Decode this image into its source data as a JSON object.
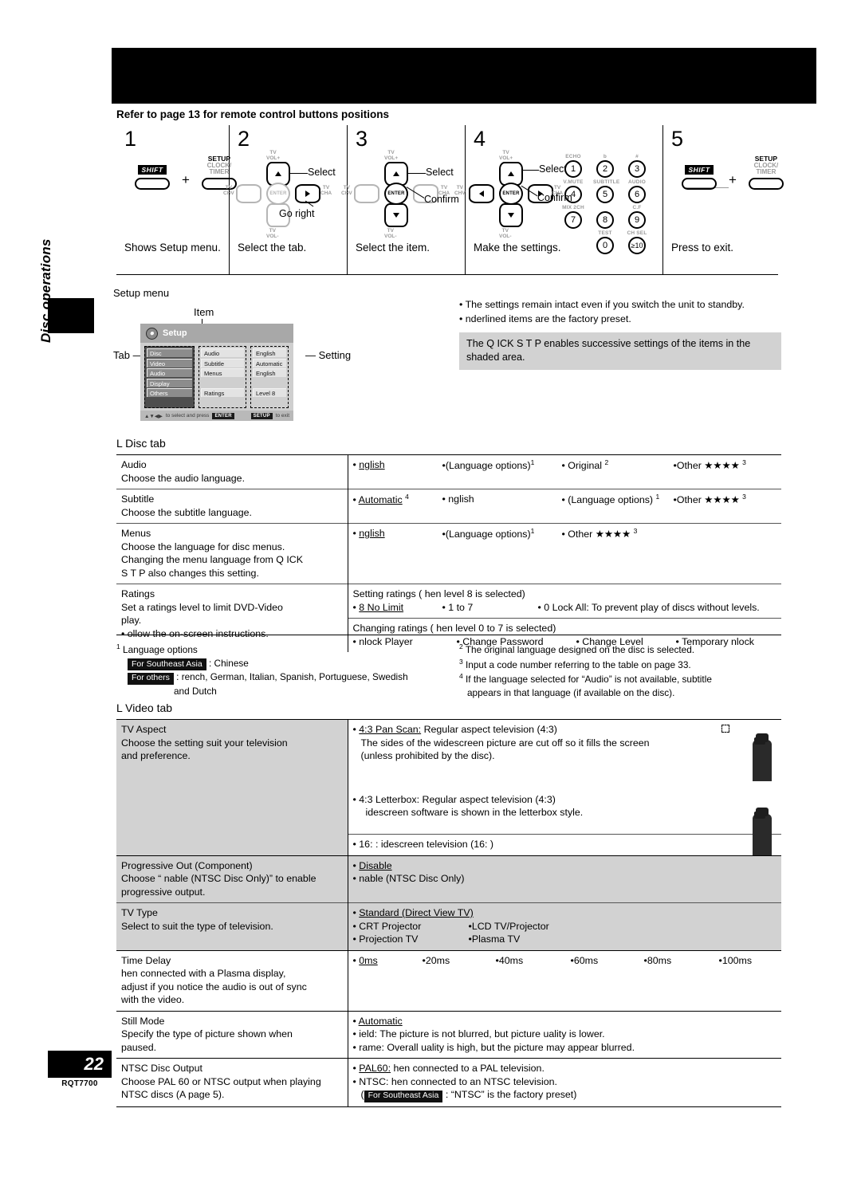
{
  "sidebar": {
    "section_label": "Disc operations",
    "page_number": "22",
    "doc_code": "RQT7700"
  },
  "header": {
    "refer_note": "Refer to page 13 for remote control buttons positions"
  },
  "steps": [
    {
      "number": "1",
      "caption": "Shows Setup menu.",
      "keys": {
        "shift": "SHIFT",
        "plus": "+",
        "setup": "SETUP",
        "setup_sub1": "CLOCK/",
        "setup_sub2": "TIMER"
      }
    },
    {
      "number": "2",
      "caption": "Select the tab.",
      "callouts": [
        "Select",
        "Go right"
      ],
      "pad_tags": {
        "up": "TV\nVOL+",
        "down": "TV\nVOL-",
        "left": "TV\nCHV",
        "right": "TV\nCHA",
        "center": "ENTER"
      }
    },
    {
      "number": "3",
      "caption": "Select the item.",
      "callouts": [
        "Select",
        "Confirm"
      ],
      "pad_tags": {
        "up": "TV\nVOL+",
        "down": "TV\nVOL-",
        "left": "TV\nCHV",
        "right": "TV\nCHA",
        "center": "ENTER"
      }
    },
    {
      "number": "4",
      "caption": "Make the settings.",
      "callouts": [
        "Select",
        "Confirm"
      ],
      "keypad": [
        {
          "top": "ECHO",
          "label": "1"
        },
        {
          "top": "b",
          "label": "2"
        },
        {
          "top": "#",
          "label": "3"
        },
        {
          "top": "V.MUTE",
          "label": "4"
        },
        {
          "top": "SUBTITLE",
          "label": "5"
        },
        {
          "top": "AUDIO",
          "label": "6"
        },
        {
          "top": "MIX 2CH",
          "label": "7"
        },
        {
          "top": "",
          "label": "8"
        },
        {
          "top": "C.F",
          "label": "9"
        },
        {
          "top": "",
          "label": ""
        },
        {
          "top": "TEST",
          "label": "0"
        },
        {
          "top": "CH SEL",
          "label": "≥10"
        }
      ]
    },
    {
      "number": "5",
      "caption": "Press to exit.",
      "keys": {
        "shift": "SHIFT",
        "plus": "+",
        "setup": "SETUP",
        "setup_sub1": "CLOCK/",
        "setup_sub2": "TIMER"
      }
    }
  ],
  "figure": {
    "title": "Setup menu",
    "label_item": "Item",
    "label_tab": "Tab",
    "label_setting": "Setting",
    "screen_title": "Setup",
    "tabs": [
      "Disc",
      "Video",
      "Audio",
      "Display",
      "Others"
    ],
    "items": [
      "Audio",
      "Subtitle",
      "Menus",
      "",
      "Ratings"
    ],
    "settings": [
      "English",
      "Automatic",
      "English",
      "",
      "Level 8"
    ],
    "footer_left": "to select and press",
    "footer_enter": "ENTER",
    "footer_exit_key": "SETUP",
    "footer_exit": "to exit"
  },
  "notes": {
    "bullets": [
      "The settings remain intact even if you switch the unit to standby.",
      " nderlined items are the factory preset."
    ],
    "tip": "The Q ICK S T P enables successive settings of the items in the shaded area."
  },
  "disc_tab": {
    "heading": "L   Disc   tab",
    "rows": [
      {
        "name": "Audio",
        "desc": [
          "Choose the audio language."
        ],
        "options": [
          {
            "text": " nglish",
            "underline": true
          },
          {
            "text": "(Language options)",
            "sup": "1"
          },
          {
            "text": "Original",
            "sup": "2"
          },
          {
            "text": "Other ★★★★",
            "sup": "3"
          }
        ]
      },
      {
        "name": "Subtitle",
        "desc": [
          "Choose the subtitle language."
        ],
        "options": [
          {
            "text": "Automatic",
            "underline": true,
            "sup": "4"
          },
          {
            "text": " nglish"
          },
          {
            "text": "(Language options)",
            "sup": "1"
          },
          {
            "text": "Other ★★★★",
            "sup": "3"
          }
        ]
      },
      {
        "name": "Menus",
        "desc": [
          "Choose the language for disc menus.",
          "Changing the menu language from Q  ICK",
          "S  T  P also changes this setting."
        ],
        "options": [
          {
            "text": " nglish",
            "underline": true
          },
          {
            "text": "(Language options)",
            "sup": "1"
          },
          {
            "text": "Other ★★★★",
            "sup": "3"
          }
        ]
      }
    ],
    "ratings": {
      "name": "Ratings",
      "desc": [
        "Set a ratings level to limit DVD-Video",
        "play.",
        "•  ollow the on-screen instructions."
      ],
      "group1_title": "Setting ratings (    hen level 8 is selected)",
      "group1": [
        {
          "text": "8 No Limit",
          "underline": true
        },
        {
          "text": "1 to 7"
        },
        {
          "text": "0 Lock All: To prevent play of discs without levels."
        }
      ],
      "group2_title": "Changing ratings (    hen level 0 to 7 is selected)",
      "group2": [
        {
          "text": " nlock Player"
        },
        {
          "text": "Change Password"
        },
        {
          "text": "Change Level"
        },
        {
          "text": "Temporary   nlock"
        }
      ]
    },
    "footnotes_left": {
      "marker": "1",
      "title": "Language options",
      "lines": [
        {
          "badge": "For Southeast Asia",
          "text": ": Chinese"
        },
        {
          "badge": "For others",
          "text": ":    rench, German, Italian, Spanish, Portuguese, Swedish"
        },
        {
          "badge": "",
          "text": "and Dutch",
          "indent": true
        }
      ]
    },
    "footnotes_right": [
      {
        "marker": "2",
        "text": "The original language designed on the disc is selected."
      },
      {
        "marker": "3",
        "text": "Input a code number referring to the table on page 33."
      },
      {
        "marker": "4",
        "text": "If the language selected for “Audio” is not available, subtitle"
      },
      {
        "marker": "",
        "text": "appears in that language (if available on the disc)."
      }
    ]
  },
  "video_tab": {
    "heading": "L   Video   tab",
    "tv_aspect": {
      "name": "TV Aspect",
      "desc": [
        "Choose the setting suit your television",
        "and preference."
      ],
      "block1": {
        "lead": "4:3 Pan  Scan:",
        "lead_rest": " Regular aspect television (4:3)",
        "body": [
          "The sides of the widescreen picture are cut off so it fills the screen",
          "(unless prohibited by the disc)."
        ],
        "thumb": "pan-scan"
      },
      "block2": {
        "lead": "4:3 Letterbox: Regular aspect television (4:3)",
        "body": [
          "idescreen software is shown in the letterbox style."
        ],
        "thumb": "letterbox"
      },
      "block3": {
        "lead": "16:  :    idescreen television (16: )"
      }
    },
    "progressive": {
      "name": "Progressive Out (Component)",
      "desc": [
        "Choose “  nable (NTSC Disc Only)” to enable",
        "progressive output."
      ],
      "options": [
        {
          "text": "Disable",
          "underline": true
        },
        {
          "text": " nable (NTSC Disc Only)"
        }
      ]
    },
    "tv_type": {
      "name": "TV Type",
      "desc": [
        "Select to suit the type of television."
      ],
      "options": [
        {
          "text": "Standard (Direct View TV)",
          "underline": true
        },
        {
          "text": "CRT Projector"
        },
        {
          "text": "LCD TV/Projector"
        },
        {
          "text": "Projection TV"
        },
        {
          "text": "Plasma TV"
        }
      ]
    },
    "time_delay": {
      "name": "Time Delay",
      "desc": [
        "  hen connected with a Plasma display,",
        "adjust if you notice the audio is out of sync",
        "with the video."
      ],
      "options": [
        {
          "text": "0ms",
          "underline": true
        },
        {
          "text": "20ms"
        },
        {
          "text": "40ms"
        },
        {
          "text": "60ms"
        },
        {
          "text": "80ms"
        },
        {
          "text": "100ms"
        }
      ]
    },
    "still_mode": {
      "name": "Still Mode",
      "desc": [
        "Specify the type of picture shown when",
        "paused."
      ],
      "options": [
        {
          "text": "Automatic",
          "underline": true
        },
        {
          "text": " ield:   The picture is not blurred, but picture   uality is lower."
        },
        {
          "text": " rame: Overall   uality is high, but the picture may appear blurred."
        }
      ]
    },
    "ntsc_output": {
      "name": "NTSC Disc Output",
      "desc": [
        "Choose PAL 60 or NTSC output when playing",
        "NTSC discs (A  page 5)."
      ],
      "options": [
        {
          "lead": "PAL60:",
          "underline": true,
          "rest": "   hen connected to a PAL television."
        },
        {
          "lead": "NTSC:",
          "underline": false,
          "rest": "   hen connected to an NTSC television."
        }
      ],
      "preset_prefix": "(",
      "preset_badge": "For Southeast Asia",
      "preset_text": ": “NTSC” is the factory preset)"
    }
  }
}
